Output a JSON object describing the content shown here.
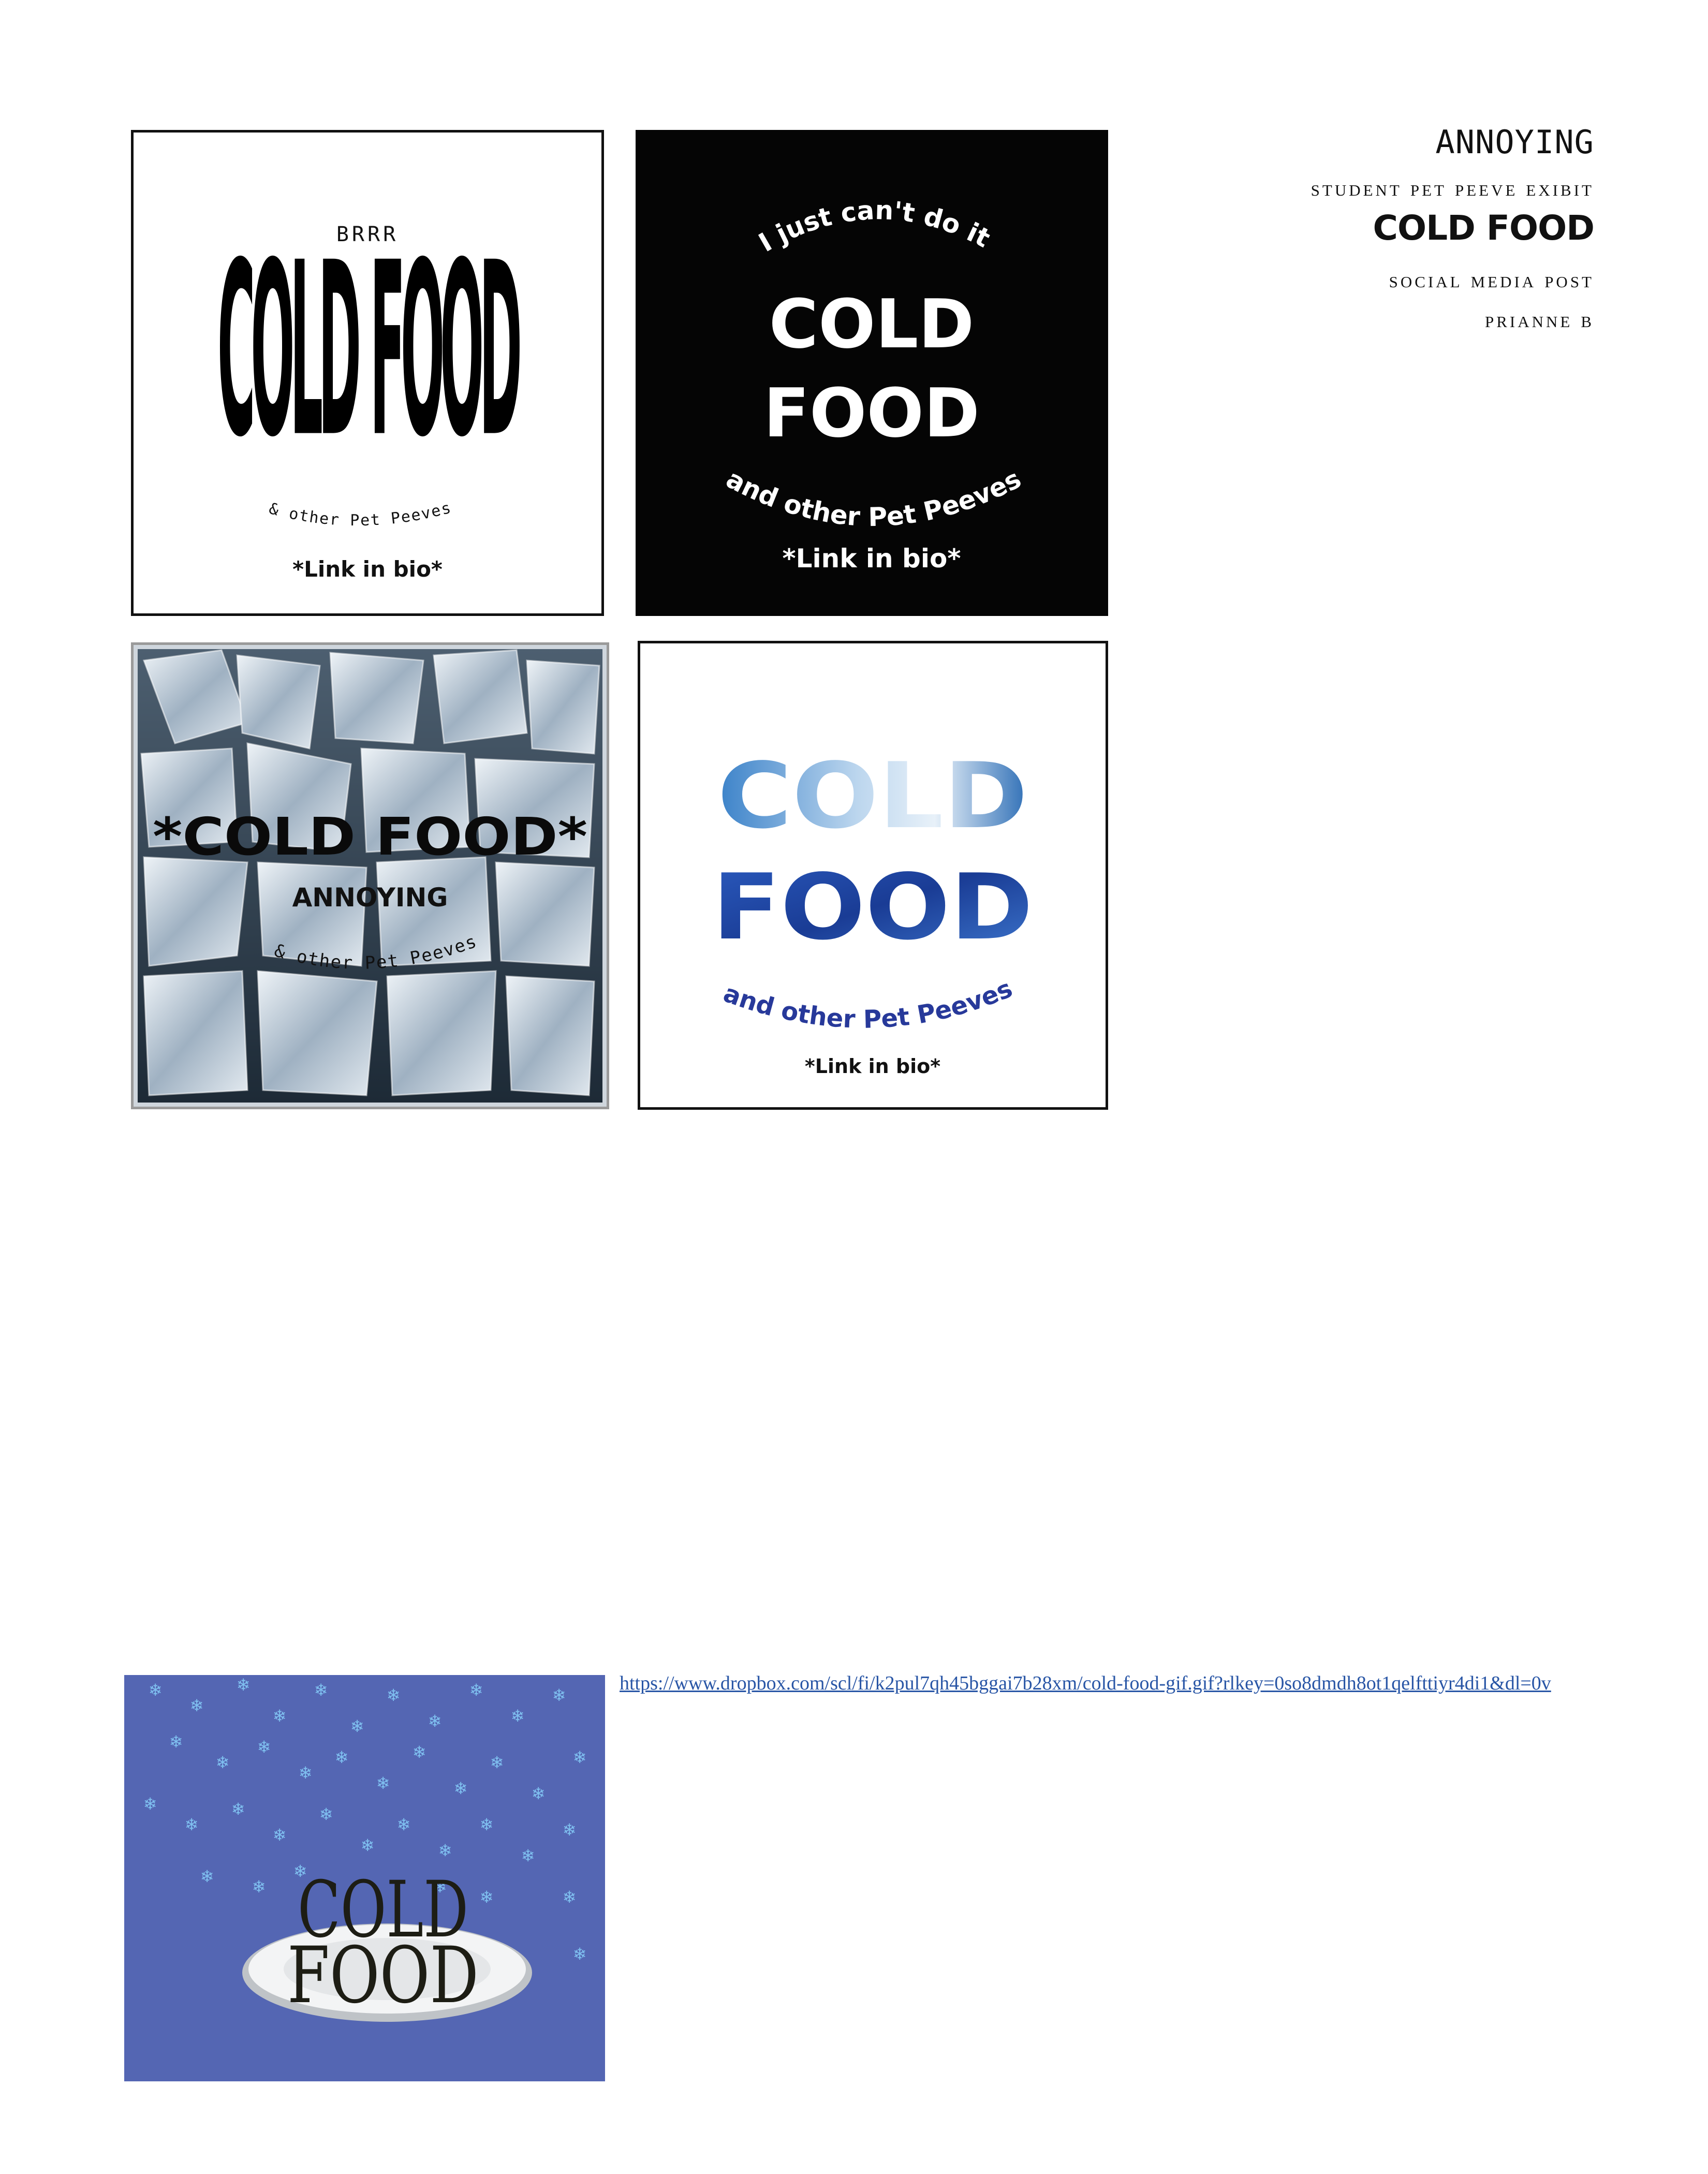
{
  "header": {
    "title": "ANNOYING",
    "exhibit": "Student Pet Peeve Exibit",
    "project": "COLD FOOD",
    "type": "Social Media Post",
    "author": "Prianne B"
  },
  "posters": [
    {
      "top_text": "BRRR",
      "main_text": "COLD FOOD",
      "sub_text": "& other Pet Peeves",
      "cta": "*Link in bio*"
    },
    {
      "top_text": "I just can't do it",
      "main_line1": "COLD",
      "main_line2": "FOOD",
      "sub_text": "and other Pet Peeves",
      "cta": "*Link in bio*"
    },
    {
      "main_text": "*COLD FOOD*",
      "sub_title": "ANNOYING",
      "sub_text": "& other Pet Peeves"
    },
    {
      "main_line1": "COLD",
      "main_line2": "FOOD",
      "sub_text": "and other Pet Peeves",
      "cta": "*Link in bio*"
    },
    {
      "main_line1": "COLD",
      "main_line2": "FOOD"
    }
  ],
  "link": {
    "text": "https://www.dropbox.com/scl/fi/k2pul7qh45bggai7b28xm/cold-food-gif.gif?rlkey=0so8dmdh8ot1qelfttiyr4di1&dl=0v"
  },
  "colors": {
    "poster_dark": "#050505",
    "ice_blue": "#3a86c8",
    "deep_blue": "#1e3f99",
    "snow_bg": "#5466b3",
    "link": "#2956a6"
  }
}
